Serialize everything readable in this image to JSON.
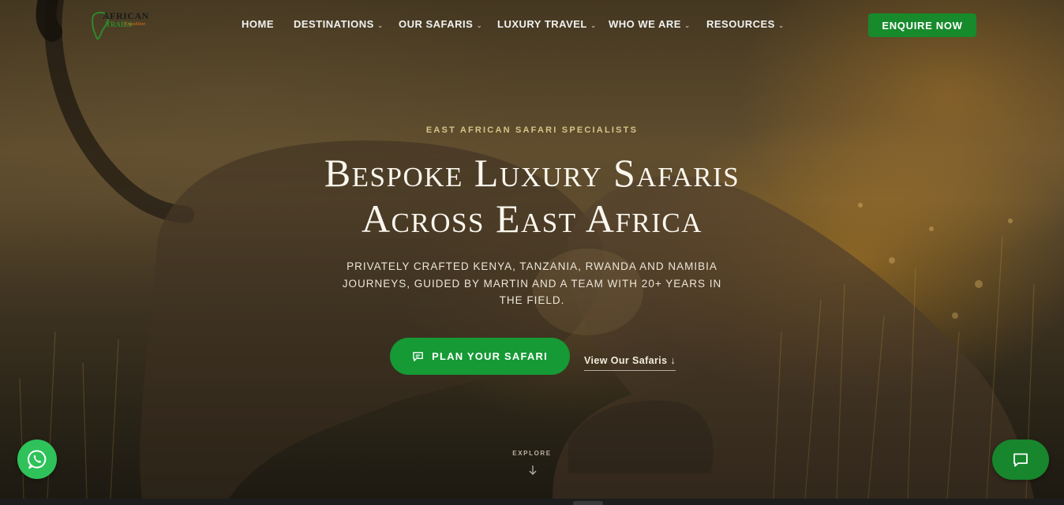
{
  "brand": {
    "logo_line1": "AFRICAN",
    "logo_line2": "TRAILS",
    "logo_line3": "Expedition"
  },
  "nav": {
    "items": [
      {
        "label": "HOME",
        "has_dropdown": false
      },
      {
        "label": "DESTINATIONS",
        "has_dropdown": true
      },
      {
        "label": "OUR SAFARIS",
        "has_dropdown": true
      },
      {
        "label": "LUXURY TRAVEL",
        "has_dropdown": true
      },
      {
        "label": "WHO WE ARE",
        "has_dropdown": true
      },
      {
        "label": "RESOURCES",
        "has_dropdown": true
      }
    ],
    "dropdown_glyph": "⌄",
    "cta_label": "ENQUIRE NOW"
  },
  "hero": {
    "eyebrow": "EAST AFRICAN SAFARI SPECIALISTS",
    "headline_line1": "Bespoke Luxury Safaris",
    "headline_line2": "Across East Africa",
    "subheading": "PRIVATELY CRAFTED KENYA, TANZANIA, RWANDA AND NAMIBIA JOURNEYS, GUIDED BY MARTIN AND A TEAM WITH 20+ YEARS IN THE FIELD.",
    "primary_cta": "PLAN YOUR SAFARI",
    "secondary_cta": "View Our Safaris ↓",
    "explore_label": "EXPLORE"
  },
  "icons": {
    "primary_cta_icon": "chat-bubble-icon",
    "whatsapp": "whatsapp-icon",
    "chat": "chat-bubble-icon",
    "explore": "arrow-down-icon"
  },
  "colors": {
    "accent_green": "#178a2c",
    "whatsapp_green": "#2fc25a",
    "eyebrow_gold": "#d6c48a",
    "text_light": "#fbf7ee"
  }
}
